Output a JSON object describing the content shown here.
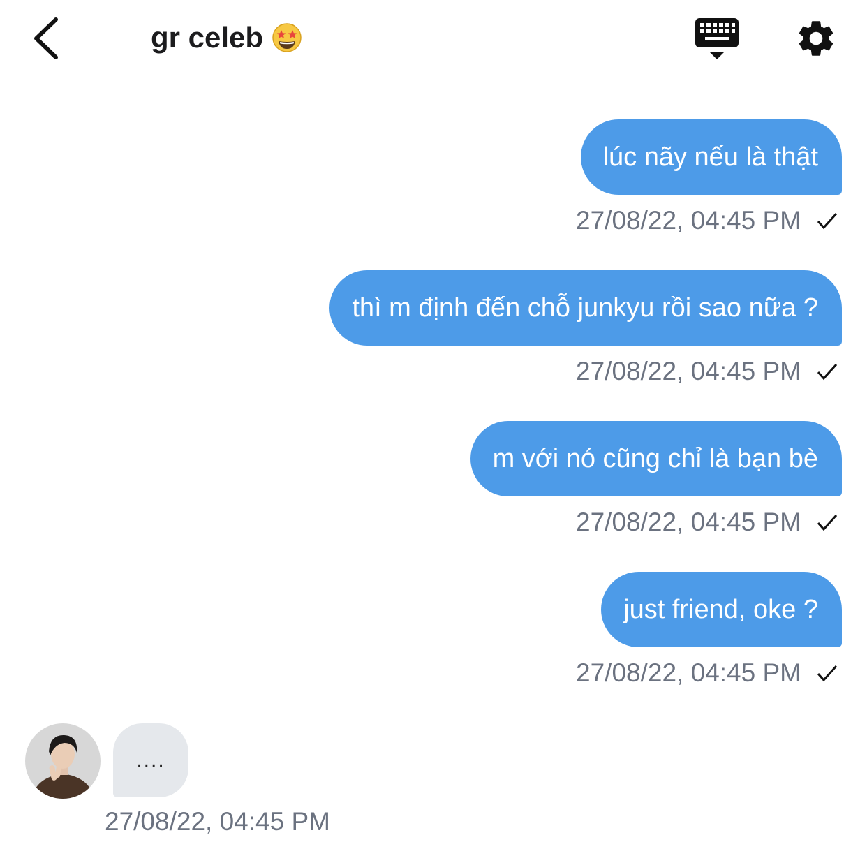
{
  "header": {
    "back_icon": "chevron-left-icon",
    "title": "gr celeb",
    "title_emoji": "star-struck-emoji",
    "keyboard_icon": "keyboard-icon",
    "settings_icon": "gear-icon"
  },
  "messages_out": [
    {
      "text": "lúc nãy nếu là thật",
      "time": "27/08/22, 04:45 PM",
      "status": "sent-check-icon"
    },
    {
      "text": "thì m định đến chỗ junkyu rồi sao nữa ?",
      "time": "27/08/22, 04:45 PM",
      "status": "sent-check-icon"
    },
    {
      "text": "m với nó cũng chỉ là bạn bè",
      "time": "27/08/22, 04:45 PM",
      "status": "sent-check-icon"
    },
    {
      "text": "just friend, oke ?",
      "time": "27/08/22, 04:45 PM",
      "status": "sent-check-icon"
    }
  ],
  "message_in": {
    "text": "....",
    "time": "27/08/22, 04:45 PM",
    "avatar": "contact-avatar"
  },
  "colors": {
    "outgoing_bubble": "#4d9be8",
    "incoming_bubble": "#e5e8ec",
    "timestamp": "#6b7280"
  }
}
